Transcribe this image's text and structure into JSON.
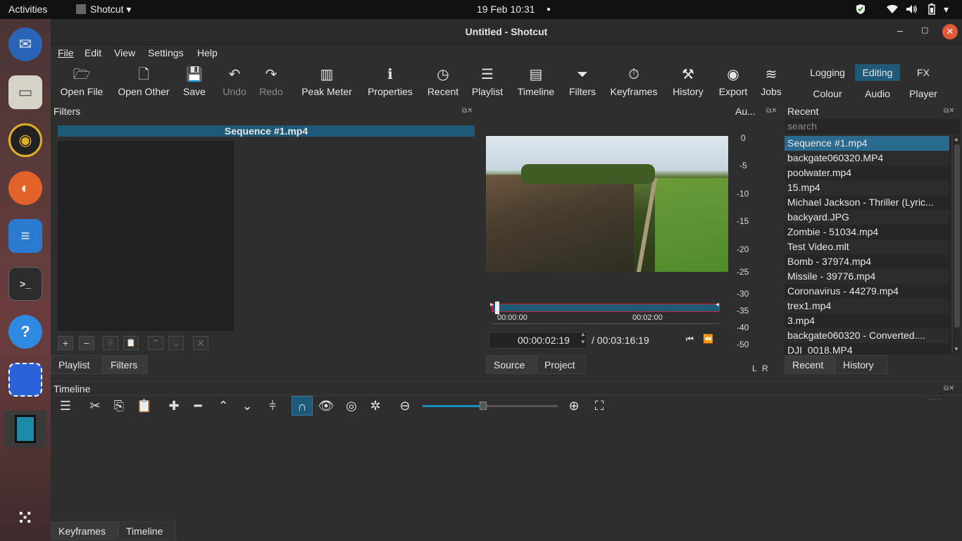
{
  "topbar": {
    "activities": "Activities",
    "app_name": "Shotcut",
    "clock": "19 Feb  10:31"
  },
  "window": {
    "title": "Untitled - Shotcut"
  },
  "menu": {
    "file": "File",
    "edit": "Edit",
    "view": "View",
    "settings": "Settings",
    "help": "Help"
  },
  "toolbar": {
    "open_file": "Open File",
    "open_other": "Open Other",
    "save": "Save",
    "undo": "Undo",
    "redo": "Redo",
    "peak_meter": "Peak Meter",
    "properties": "Properties",
    "recent": "Recent",
    "playlist": "Playlist",
    "timeline": "Timeline",
    "filters": "Filters",
    "keyframes": "Keyframes",
    "history": "History",
    "export": "Export",
    "jobs": "Jobs"
  },
  "layouts": {
    "logging": "Logging",
    "editing": "Editing",
    "fx": "FX",
    "colour": "Colour",
    "audio": "Audio",
    "player": "Player"
  },
  "filters_panel": {
    "title": "Filters",
    "clip_name": "Sequence #1.mp4",
    "tab_playlist": "Playlist",
    "tab_filters": "Filters"
  },
  "player": {
    "audio_title": "Au...",
    "current_time": "00:00:02:19",
    "total_time": "/ 00:03:16:19",
    "ruler_start": "00:00:00",
    "ruler_mark": "00:02:00",
    "progress": 0.012,
    "tab_source": "Source",
    "tab_project": "Project"
  },
  "audio_meter": {
    "labels": [
      "0",
      "-5",
      "-10",
      "-15",
      "-20",
      "-25",
      "-30",
      "-35",
      "-40",
      "-50"
    ],
    "channel_left": "L",
    "channel_right": "R"
  },
  "recent_panel": {
    "title": "Recent",
    "search_placeholder": "search",
    "items": [
      "Sequence #1.mp4",
      "backgate060320.MP4",
      "poolwater.mp4",
      "15.mp4",
      "Michael Jackson - Thriller (Lyric...",
      "backyard.JPG",
      "Zombie - 51034.mp4",
      "Test Video.mlt",
      "Bomb - 37974.mp4",
      "Missile - 39776.mp4",
      "Coronavirus - 44279.mp4",
      "trex1.mp4",
      "3.mp4",
      "backgate060320 - Converted....",
      "DJI_0018.MP4"
    ],
    "tab_recent": "Recent",
    "tab_history": "History"
  },
  "timeline_panel": {
    "title": "Timeline",
    "zoom_level": 0.45,
    "tab_keyframes": "Keyframes",
    "tab_timeline": "Timeline"
  },
  "colors": {
    "accent": "#1e5a78",
    "selection": "#2a6a8e",
    "background": "#2e2e2e",
    "close_button": "#e05a38"
  }
}
